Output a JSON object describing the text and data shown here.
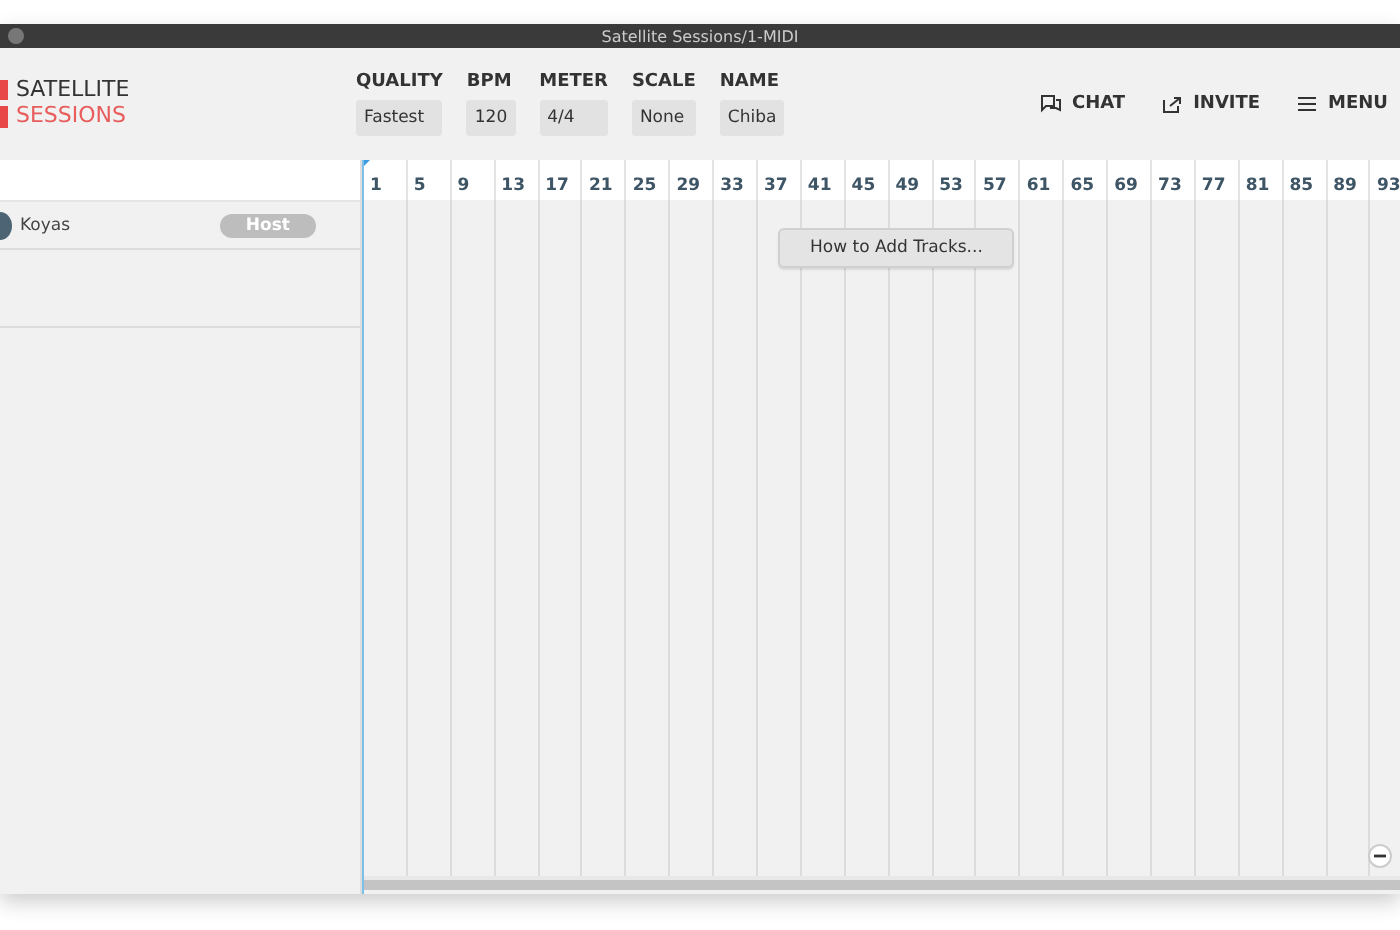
{
  "window": {
    "title": "Satellite Sessions/1-MIDI"
  },
  "logo": {
    "line_1": "SATELLITE",
    "line_2": "SESSIONS"
  },
  "settings": [
    {
      "label": "QUALITY",
      "value": "Fastest"
    },
    {
      "label": "BPM",
      "value": "120"
    },
    {
      "label": "METER",
      "value": "4/4"
    },
    {
      "label": "SCALE",
      "value": "None"
    },
    {
      "label": "NAME",
      "value": "Chiba"
    }
  ],
  "actions": [
    {
      "kind": "chat",
      "label": "CHAT"
    },
    {
      "kind": "invite",
      "label": "INVITE"
    },
    {
      "kind": "menu",
      "label": "MENU"
    }
  ],
  "participants": [
    {
      "name": "Koyas",
      "role": "Host"
    }
  ],
  "ruler": [
    "1",
    "5",
    "9",
    "13",
    "17",
    "21",
    "25",
    "29",
    "33",
    "37",
    "41",
    "45",
    "49",
    "53",
    "57",
    "61",
    "65",
    "69",
    "73",
    "77",
    "81",
    "85",
    "89",
    "93"
  ],
  "hint_button": "How to Add Tracks..."
}
